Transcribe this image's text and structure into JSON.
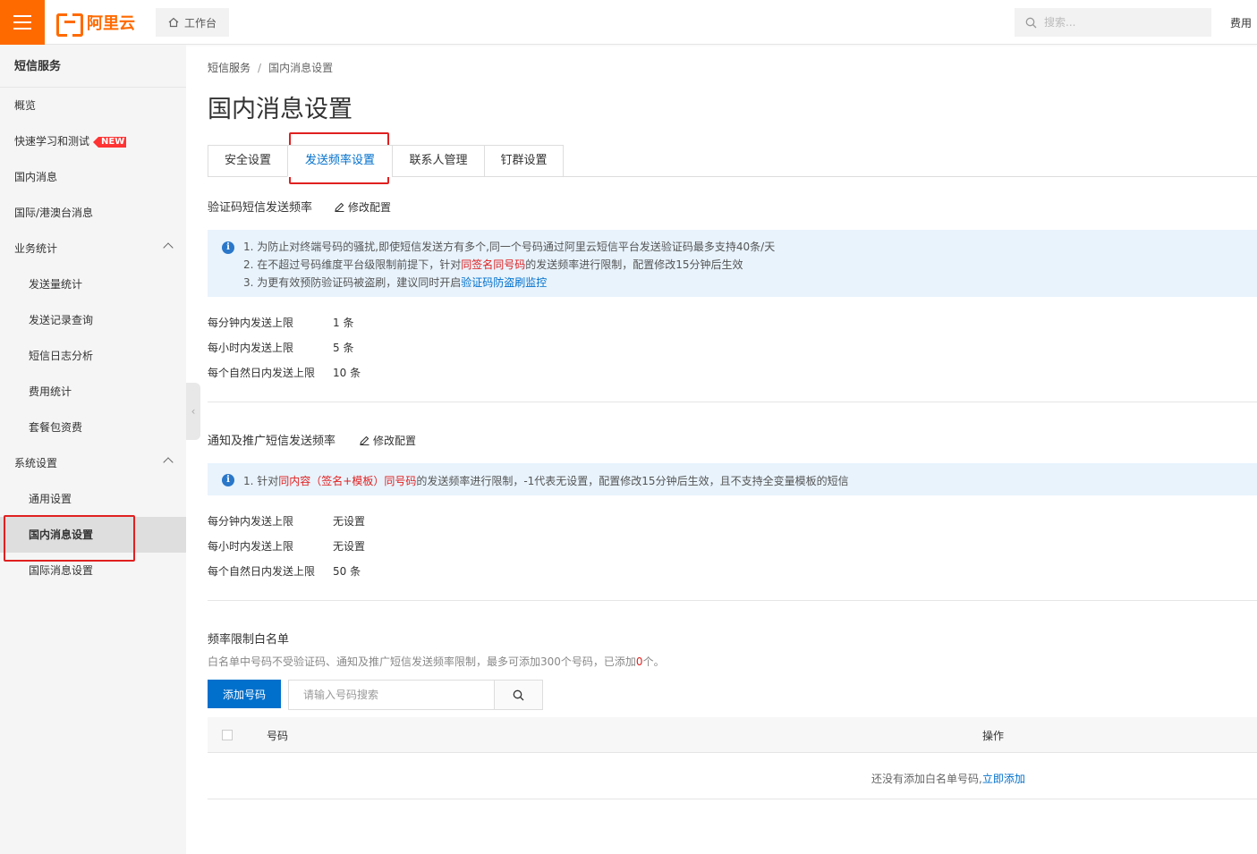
{
  "topbar": {
    "logo_text": "阿里云",
    "workbench_label": "工作台",
    "search_placeholder": "搜索...",
    "fee_label": "费用"
  },
  "sidebar": {
    "title": "短信服务",
    "items": [
      {
        "label": "概览"
      },
      {
        "label": "快速学习和测试",
        "badge": "NEW"
      },
      {
        "label": "国内消息"
      },
      {
        "label": "国际/港澳台消息"
      },
      {
        "label": "业务统计"
      },
      {
        "label": "发送量统计"
      },
      {
        "label": "发送记录查询"
      },
      {
        "label": "短信日志分析"
      },
      {
        "label": "费用统计"
      },
      {
        "label": "套餐包资费"
      },
      {
        "label": "系统设置"
      },
      {
        "label": "通用设置"
      },
      {
        "label": "国内消息设置"
      },
      {
        "label": "国际消息设置"
      }
    ]
  },
  "breadcrumb": {
    "root": "短信服务",
    "separator": "/",
    "current": "国内消息设置"
  },
  "page_title": "国内消息设置",
  "tabs": [
    "安全设置",
    "发送频率设置",
    "联系人管理",
    "钉群设置"
  ],
  "verify_section": {
    "title": "验证码短信发送频率",
    "edit_label": "修改配置",
    "notice": {
      "line1": "1. 为防止对终端号码的骚扰,即使短信发送方有多个,同一个号码通过阿里云短信平台发送验证码最多支持40条/天",
      "line2_a": "2. 在不超过号码维度平台级限制前提下，针对",
      "line2_red": "同签名同号码",
      "line2_b": "的发送频率进行限制，配置修改15分钟后生效",
      "line3_a": "3. 为更有效预防验证码被盗刷，建议同时开启",
      "line3_link": "验证码防盗刷监控"
    },
    "limits": [
      {
        "label": "每分钟内发送上限",
        "value": "1 条"
      },
      {
        "label": "每小时内发送上限",
        "value": "5 条"
      },
      {
        "label": "每个自然日内发送上限",
        "value": "10 条"
      }
    ]
  },
  "notify_section": {
    "title": "通知及推广短信发送频率",
    "edit_label": "修改配置",
    "notice": {
      "a": "1. 针对",
      "red": "同内容（签名+模板）同号码",
      "b": "的发送频率进行限制，-1代表无设置，配置修改15分钟后生效，且不支持全变量模板的短信"
    },
    "limits": [
      {
        "label": "每分钟内发送上限",
        "value": "无设置"
      },
      {
        "label": "每小时内发送上限",
        "value": "无设置"
      },
      {
        "label": "每个自然日内发送上限",
        "value": "50 条"
      }
    ]
  },
  "whitelist": {
    "title": "频率限制白名单",
    "desc_a": "白名单中号码不受验证码、通知及推广短信发送频率限制，最多可添加300个号码，已添加",
    "desc_count": "0",
    "desc_b": "个。",
    "add_button": "添加号码",
    "search_placeholder": "请输入号码搜索",
    "columns": [
      "号码",
      "操作"
    ],
    "empty_text": "还没有添加白名单号码,",
    "empty_link": "立即添加"
  },
  "colors": {
    "brand": "#ff6a00",
    "primary": "#0070cc",
    "highlight_red": "#e02020",
    "notice_bg": "#e8f3fc"
  }
}
